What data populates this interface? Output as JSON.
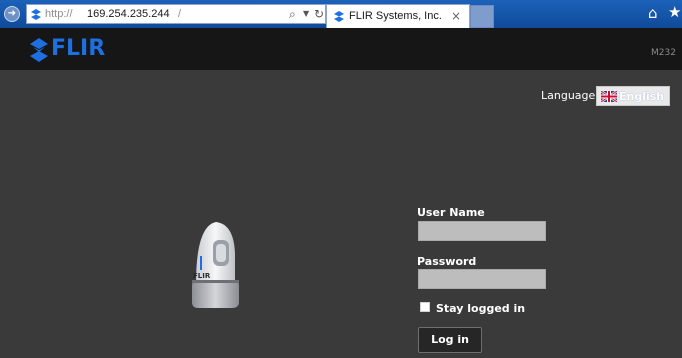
{
  "browser": {
    "address_prefix": "http://",
    "address_host": "169.254.235.244",
    "address_suffix": "/",
    "tab_title": "FLIR Systems, Inc.",
    "icons": [
      "back-icon",
      "search-icon",
      "dropdown-icon",
      "refresh-icon",
      "close-icon",
      "home-icon",
      "star-icon"
    ]
  },
  "header": {
    "logo_text": "FLIR",
    "model": "M232",
    "brand_color": "#1e6fe0"
  },
  "language": {
    "label": "Language",
    "selected": "English",
    "flag_icon": "uk-flag-icon"
  },
  "login": {
    "username_label": "User Name",
    "username_value": "",
    "password_label": "Password",
    "password_value": "",
    "stay_logged_in_label": "Stay logged in",
    "stay_logged_in_checked": false,
    "submit_label": "Log in"
  },
  "camera": {
    "brand_mark": "FLIR"
  },
  "colors": {
    "page_background": "#3a3a3a",
    "header_background": "#161616",
    "chrome_blue": "#1c62b9"
  }
}
